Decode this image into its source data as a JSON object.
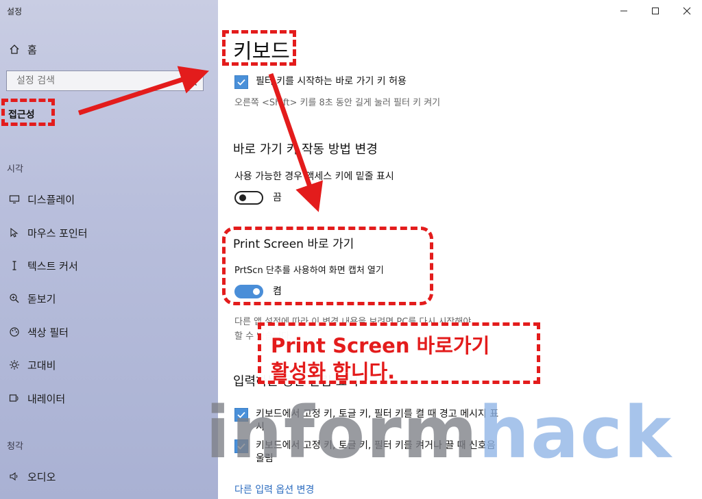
{
  "window": {
    "title": "설정"
  },
  "sidebar": {
    "home": "홈",
    "search_placeholder": "설정 검색",
    "category": "접근성",
    "section_vision": "시각",
    "vision_items": [
      {
        "label": "디스플레이",
        "icon": "monitor-icon"
      },
      {
        "label": "마우스 포인터",
        "icon": "mouse-pointer-icon"
      },
      {
        "label": "텍스트 커서",
        "icon": "text-cursor-icon"
      },
      {
        "label": "돋보기",
        "icon": "magnifier-icon"
      },
      {
        "label": "색상 필터",
        "icon": "palette-icon"
      },
      {
        "label": "고대비",
        "icon": "contrast-icon"
      },
      {
        "label": "내레이터",
        "icon": "narrator-icon"
      }
    ],
    "section_hearing": "청각",
    "hearing_items": [
      {
        "label": "오디오",
        "icon": "speaker-icon"
      }
    ]
  },
  "main": {
    "title": "키보드",
    "filter_keys_checkbox": "필터 키를 시작하는 바로 가기 키 허용",
    "filter_keys_sub": "오른쪽 <Shift> 키를 8초 동안 길게 눌러 필터 키 켜기",
    "shortcut_heading": "바로 가기 키 작동 방법 변경",
    "underline_label": "사용 가능한 경우 액세스 키에 밑줄 표시",
    "underline_state": "끔",
    "printscreen_heading": "Print Screen 바로 가기",
    "printscreen_label": "PrtScn 단추를 사용하여 화면 캡처 열기",
    "printscreen_state": "켬",
    "printscreen_note_1": "다른 앱 설정에 따라 이 변경 내용을 보려면 PC를 다시 시작해야",
    "printscreen_note_2": "할 수 있습니다.",
    "typing_heading": "입력하는 동안 알림 표시",
    "warn_checkbox": "키보드에서 고정 키, 토글 키, 필터 키를 켤 때 경고 메시지 표",
    "warn_checkbox_cont": "시",
    "sound_checkbox": "키보드에서 고정 키, 토글 키, 필터 키를 켜거나 끌 때 신호음",
    "sound_checkbox_cont": "울림",
    "more_link": "다른 입력 옵션 변경"
  },
  "annotation": {
    "line1": "Print Screen 바로가기",
    "line2": "활성화 합니다."
  },
  "watermark": {
    "part1": "inform",
    "part2": "hack"
  },
  "colors": {
    "accent": "#4a90d9",
    "annotation": "#e31c1c",
    "link": "#2a6bbf"
  }
}
